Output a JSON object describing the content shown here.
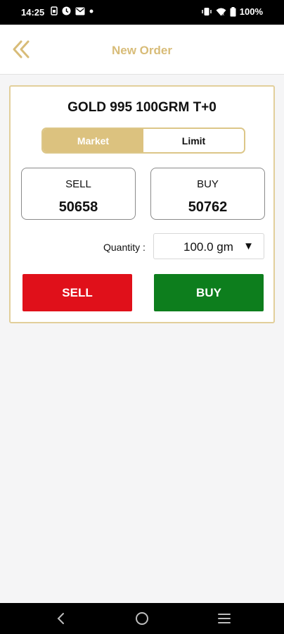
{
  "status_bar": {
    "time": "14:25",
    "battery": "100%",
    "left_icons": [
      "sim-icon",
      "clock-icon",
      "mail-icon",
      "dot-icon"
    ],
    "right_icons": [
      "vibrate-icon",
      "wifi-icon",
      "battery-icon"
    ]
  },
  "header": {
    "title": "New Order",
    "back_icon": "double-chevron-left-icon"
  },
  "order": {
    "instrument": "GOLD 995 100GRM T+0",
    "order_types": [
      "Market",
      "Limit"
    ],
    "selected_type": "Market",
    "sell_box": {
      "label": "SELL",
      "price": "50658"
    },
    "buy_box": {
      "label": "BUY",
      "price": "50762"
    },
    "quantity_label": "Quantity :",
    "quantity_value": "100.0 gm",
    "sell_button": "SELL",
    "buy_button": "BUY"
  },
  "colors": {
    "accent": "#d8bc78",
    "sell": "#e0101a",
    "buy": "#0d7e1d"
  },
  "nav": [
    "back-icon",
    "home-icon",
    "recents-icon"
  ]
}
